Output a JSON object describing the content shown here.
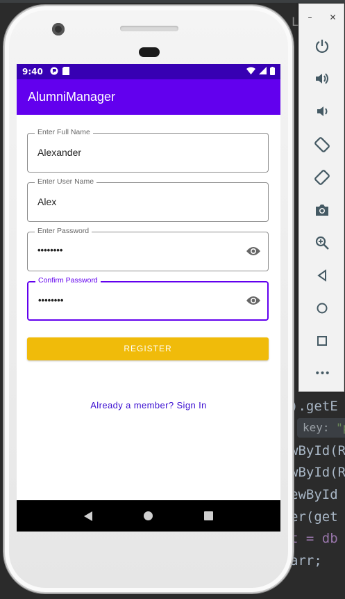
{
  "ide": {
    "top_fragment": "LA",
    "lines": [
      {
        "pre": "",
        "code": ").getE"
      },
      {
        "pre": "",
        "code": "wById(R"
      },
      {
        "pre": "",
        "code": "wById(R"
      },
      {
        "pre": "",
        "code": "ewById"
      },
      {
        "pre": "",
        "code": "er(get"
      },
      {
        "pre": "",
        "code": "t = db"
      },
      {
        "pre": "",
        "code": "arr;"
      }
    ],
    "hint_key": "key:",
    "hint_val": "\"p"
  },
  "status_bar": {
    "time": "9:40"
  },
  "app": {
    "title": "AlumniManager"
  },
  "form": {
    "full_name": {
      "label": "Enter Full Name",
      "value": "Alexander"
    },
    "user_name": {
      "label": "Enter User Name",
      "value": "Alex"
    },
    "password": {
      "label": "Enter Password",
      "value": "••••••••"
    },
    "confirm_password": {
      "label": "Confirm Password",
      "value": "••••••••"
    },
    "register_label": "REGISTER",
    "signin_link": "Already a member? Sign In"
  },
  "emulator_panel": {
    "minimize": "–",
    "close": "✕",
    "buttons": [
      "power-icon",
      "volume-up-icon",
      "volume-down-icon",
      "rotate-left-icon",
      "rotate-right-icon",
      "camera-icon",
      "zoom-icon",
      "back-icon",
      "home-icon",
      "overview-icon",
      "more-icon"
    ],
    "more_label": "•••"
  },
  "colors": {
    "primary": "#6200ee",
    "primary_dark": "#3700b3",
    "register": "#f0bb0a",
    "link": "#3a0dd1"
  }
}
